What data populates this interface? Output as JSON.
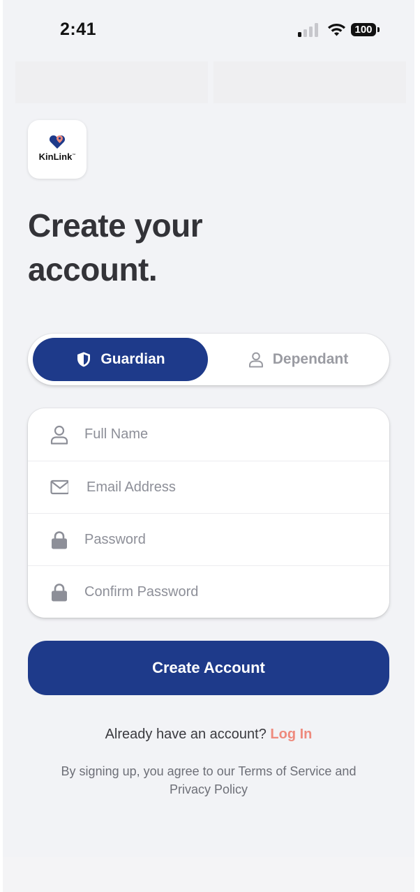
{
  "status_bar": {
    "time": "2:41",
    "battery": "100",
    "signal_bars_active": 1,
    "icons": [
      "cellular-signal-icon",
      "wifi-icon",
      "battery-icon"
    ]
  },
  "app": {
    "logo_text": "KinLink",
    "logo_trademark": "™",
    "brand_color": "#1e3a8a",
    "accent_color": "#ee8a7d"
  },
  "page": {
    "title_line1": "Create your",
    "title_line2": "account."
  },
  "role_toggle": {
    "selected": "Guardian",
    "options": [
      {
        "label": "Guardian",
        "icon": "shield-icon"
      },
      {
        "label": "Dependant",
        "icon": "person-icon"
      }
    ]
  },
  "form": {
    "fields": [
      {
        "placeholder": "Full Name",
        "icon": "person-icon"
      },
      {
        "placeholder": "Email Address",
        "icon": "envelope-icon"
      },
      {
        "placeholder": "Password",
        "icon": "lock-icon"
      },
      {
        "placeholder": "Confirm Password",
        "icon": "lock-icon"
      }
    ],
    "submit_label": "Create Account"
  },
  "login": {
    "prompt": "Already have an account?",
    "link": "Log In"
  },
  "terms": "By signing up, you agree to our Terms of Service and Privacy Policy"
}
